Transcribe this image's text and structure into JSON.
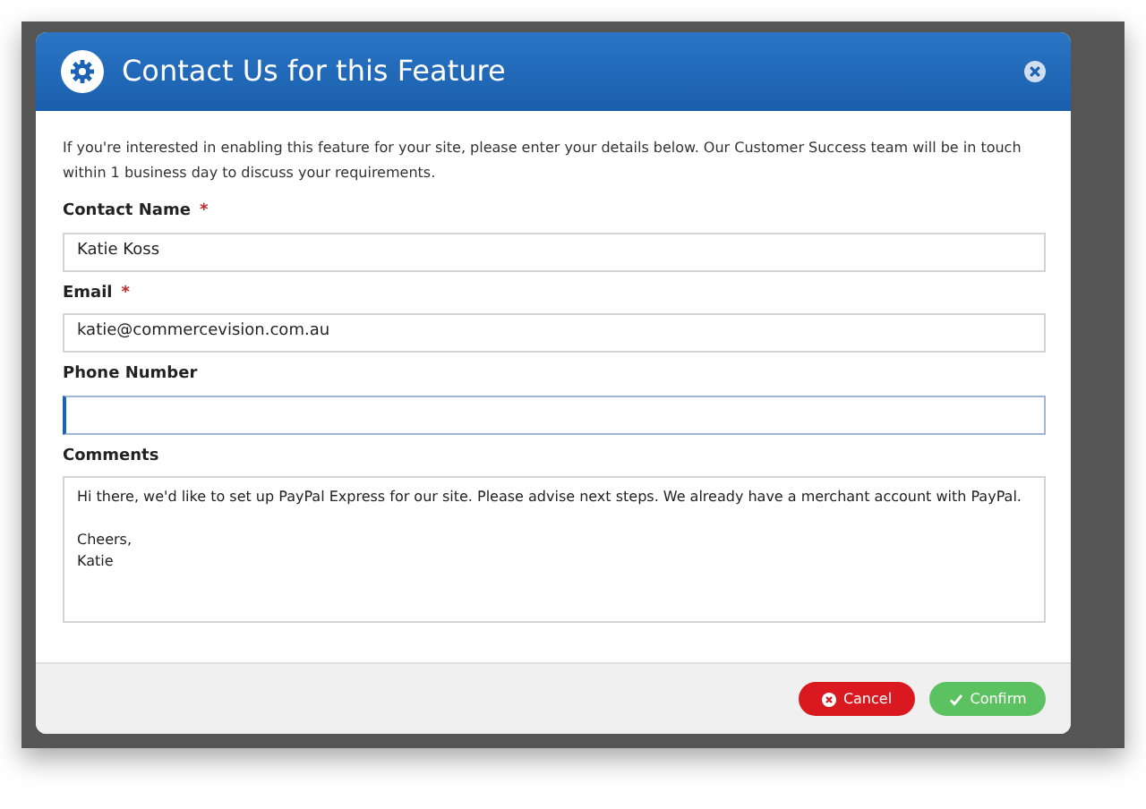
{
  "dialog": {
    "title": "Contact Us for this Feature",
    "intro": "If you're interested in enabling this feature for your site, please enter your details below. Our Customer Success team will be in touch within 1 business day to discuss your requirements.",
    "fields": [
      {
        "kind": "input",
        "label": "Contact Name",
        "required_mark": "*",
        "value": "Katie Koss",
        "focused": false
      },
      {
        "kind": "input",
        "label": "Email",
        "required_mark": "*",
        "value": "katie@commercevision.com.au",
        "focused": false
      },
      {
        "kind": "input",
        "label": "Phone Number",
        "focused": true
      },
      {
        "kind": "textarea",
        "label": "Comments",
        "value": "Hi there, we'd like to set up PayPal Express for our site. Please advise next steps. We already have a merchant account with PayPal.\n\nCheers,\nKatie",
        "focused": false
      }
    ],
    "buttons": [
      {
        "kind": "cancel",
        "label": "Cancel"
      },
      {
        "kind": "confirm",
        "label": "Confirm"
      }
    ]
  }
}
